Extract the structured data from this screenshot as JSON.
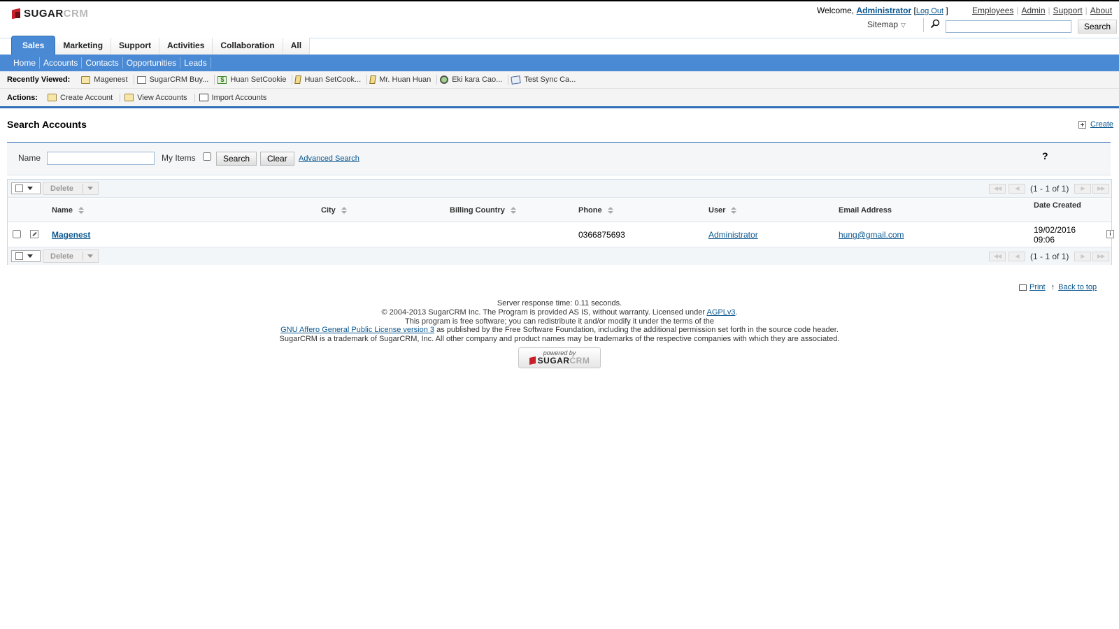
{
  "header": {
    "logo_sugar": "SUGAR",
    "logo_crm": "CRM",
    "welcome_prefix": "Welcome,",
    "user": "Administrator",
    "bracket_open": "[",
    "logout": "Log Out",
    "bracket_close": "]",
    "global_links": [
      "Employees",
      "Admin",
      "Support",
      "About"
    ],
    "sitemap": "Sitemap",
    "search_button": "Search",
    "search_value": ""
  },
  "tabs": [
    {
      "label": "Sales",
      "active": true
    },
    {
      "label": "Marketing",
      "active": false
    },
    {
      "label": "Support",
      "active": false
    },
    {
      "label": "Activities",
      "active": false
    },
    {
      "label": "Collaboration",
      "active": false
    },
    {
      "label": "All",
      "active": false
    }
  ],
  "subnav": [
    "Home",
    "Accounts",
    "Contacts",
    "Opportunities",
    "Leads"
  ],
  "recently_viewed": {
    "label": "Recently Viewed:",
    "items": [
      {
        "label": "Magenest",
        "icon": "account-folder-icon"
      },
      {
        "label": "SugarCRM Buy...",
        "icon": "document-icon"
      },
      {
        "label": "Huan SetCookie",
        "icon": "opportunity-money-icon"
      },
      {
        "label": "Huan SetCook...",
        "icon": "pencil-icon"
      },
      {
        "label": "Mr. Huan Huan",
        "icon": "pencil-icon"
      },
      {
        "label": "Eki kara Cao...",
        "icon": "lead-icon"
      },
      {
        "label": "Test Sync Ca...",
        "icon": "case-icon"
      }
    ]
  },
  "actions": {
    "label": "Actions:",
    "items": [
      {
        "label": "Create Account",
        "icon": "create-account-icon"
      },
      {
        "label": "View Accounts",
        "icon": "view-accounts-icon"
      },
      {
        "label": "Import Accounts",
        "icon": "import-icon"
      }
    ]
  },
  "page": {
    "title": "Search Accounts",
    "create_link": "Create"
  },
  "search_form": {
    "name_label": "Name",
    "name_value": "",
    "my_items_label": "My Items",
    "my_items_checked": false,
    "search_button": "Search",
    "clear_button": "Clear",
    "advanced_link": "Advanced Search",
    "help": "?"
  },
  "list": {
    "delete_label": "Delete",
    "pagination_text": "(1 - 1 of 1)",
    "columns": [
      "Name",
      "City",
      "Billing Country",
      "Phone",
      "User",
      "Email Address",
      "Date Created"
    ],
    "rows": [
      {
        "name": "Magenest",
        "city": "",
        "billing_country": "",
        "phone": "0366875693",
        "user": "Administrator",
        "email": "hung@gmail.com",
        "date_created_date": "19/02/2016",
        "date_created_time": "09:06"
      }
    ]
  },
  "footer": {
    "print": "Print",
    "back_to_top": "Back to top",
    "response_time": "Server response time: 0.11 seconds.",
    "copyright_pre": "© 2004-2013 SugarCRM Inc. The Program is provided AS IS, without warranty. Licensed under",
    "agpl_link": "AGPLv3",
    "copyright_post": ".",
    "free_software": "This program is free software; you can redistribute it and/or modify it under the terms of the",
    "gnu_link": "GNU Affero General Public License version 3",
    "gnu_post": "as published by the Free Software Foundation, including the additional permission set forth in the source code header.",
    "trademark": "SugarCRM is a trademark of SugarCRM, Inc. All other company and product names may be trademarks of the respective companies with which they are associated.",
    "powered_by": "powered by",
    "powered_sugar": "SUGAR",
    "powered_crm": "CRM"
  },
  "colors": {
    "brand_blue": "#4a8ad4",
    "link_blue": "#0b578f",
    "logo_red": "#c8202a"
  }
}
